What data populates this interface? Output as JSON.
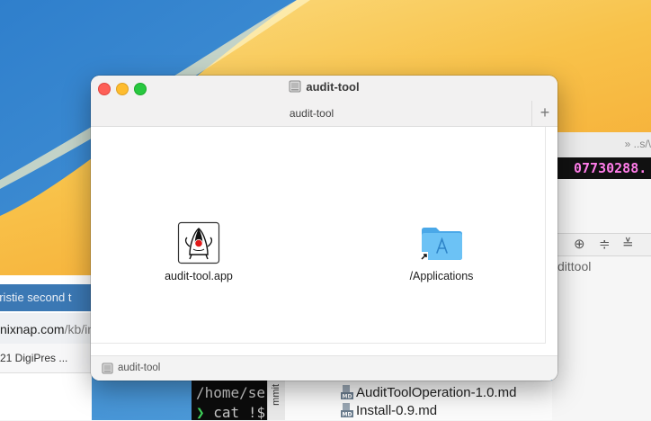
{
  "background": {
    "browser": {
      "tab_title": "hristie second t",
      "url_host": "nixnap.com",
      "url_path": "/kb/ins",
      "bookmark": "21 DigiPres ..."
    },
    "editor": {
      "breadcrumb": "» ..s/\\",
      "hash_text": "07730288.",
      "project_name": "dittool"
    },
    "terminal": {
      "line1": "/home/se",
      "prompt": "❯",
      "line2": "cat !$"
    },
    "git_panel_label": "mmit",
    "files": [
      "AuditToolOperation-1.0.md",
      "Install-0.9.md"
    ]
  },
  "window": {
    "title": "audit-tool",
    "tab_label": "audit-tool",
    "new_tab_symbol": "+",
    "items": [
      {
        "label": "audit-tool.app",
        "icon": "java-duke-app-icon"
      },
      {
        "label": "/Applications",
        "icon": "applications-folder-icon"
      }
    ],
    "status_path": "audit-tool"
  },
  "colors": {
    "close": "#fe5f57",
    "minimize": "#febc2e",
    "maximize": "#28c840",
    "folder_blue": "#5ab8f0",
    "hash_magenta": "#ff7de9"
  }
}
